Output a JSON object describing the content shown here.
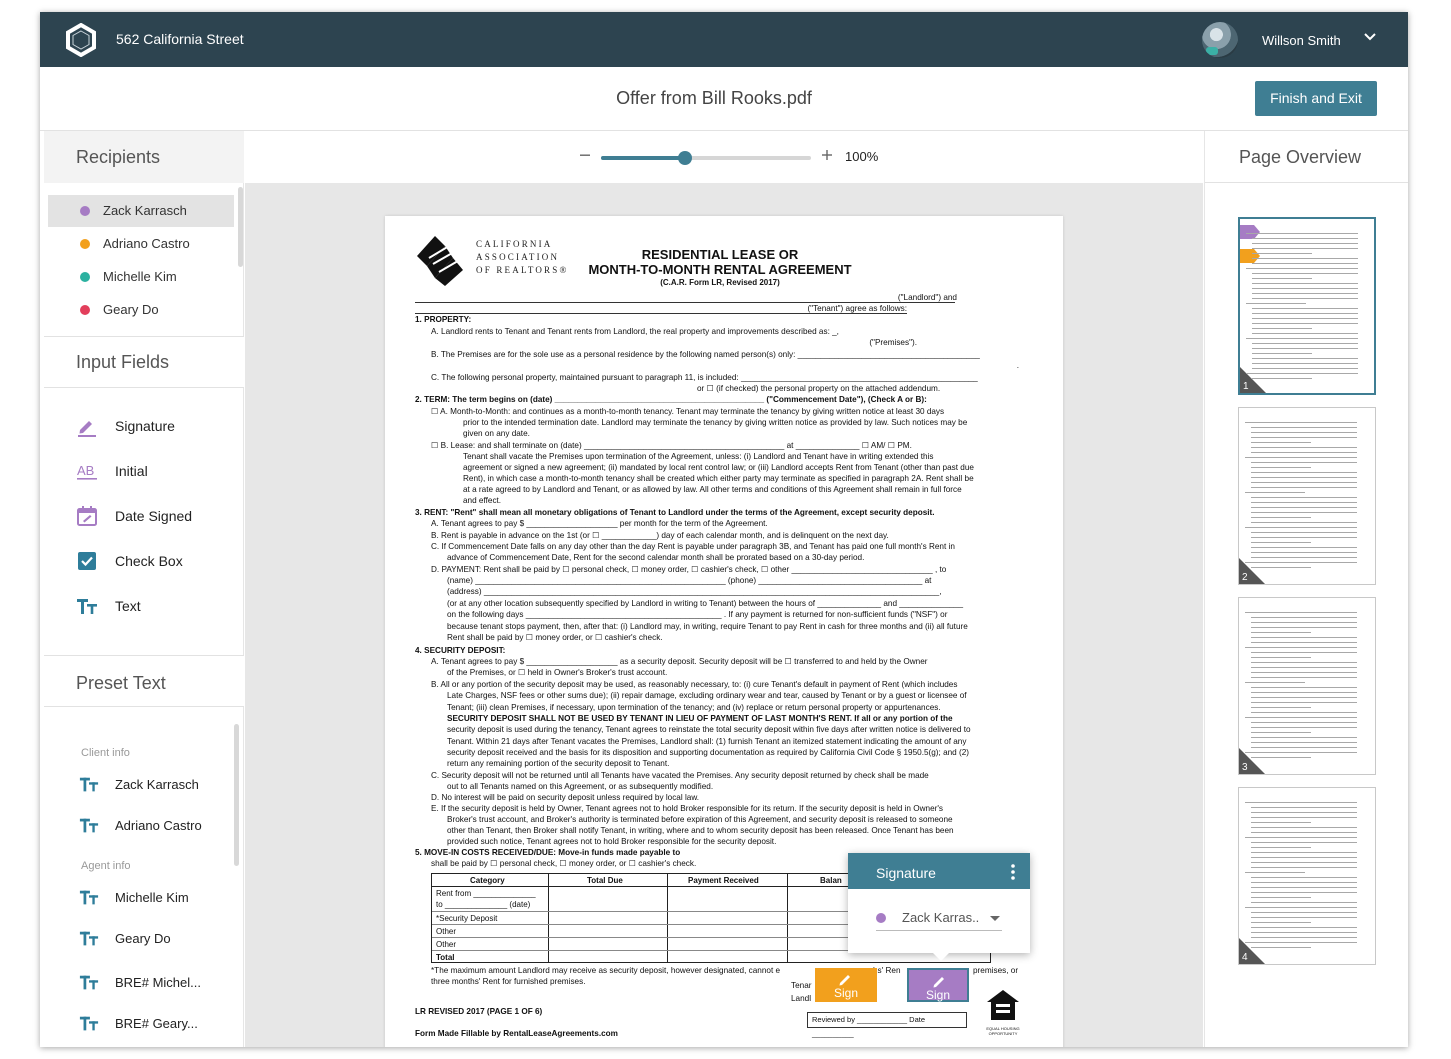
{
  "header": {
    "address": "562 California Street",
    "user_name": "Willson Smith",
    "logo_icon": "hexagon-ring-logo",
    "avatar_icon": "user-avatar",
    "dropdown_icon": "chevron-down-icon"
  },
  "document": {
    "title": "Offer from Bill Rooks.pdf",
    "finish_label": "Finish and Exit"
  },
  "left": {
    "recipients_title": "Recipients",
    "recipients": [
      {
        "name": "Zack Karrasch",
        "color": "#a67cc4"
      },
      {
        "name": "Adriano Castro",
        "color": "#f2a01d"
      },
      {
        "name": "Michelle Kim",
        "color": "#2bb1a0"
      },
      {
        "name": "Geary Do",
        "color": "#e23e5b"
      }
    ],
    "input_fields_title": "Input Fields",
    "input_fields": [
      {
        "label": "Signature",
        "icon": "pen-icon"
      },
      {
        "label": "Initial",
        "icon": "initials-ab-icon"
      },
      {
        "label": "Date Signed",
        "icon": "calendar-icon"
      },
      {
        "label": "Check Box",
        "icon": "checkbox-icon"
      },
      {
        "label": "Text",
        "icon": "text-tt-icon"
      }
    ],
    "preset_text_title": "Preset Text",
    "preset_groups": [
      {
        "label": "Client info",
        "items": [
          "Zack Karrasch",
          "Adriano Castro"
        ]
      },
      {
        "label": "Agent info",
        "items": [
          "Michelle Kim",
          "Geary Do",
          "BRE# Michel...",
          "BRE# Geary..."
        ]
      }
    ]
  },
  "zoom": {
    "value": "100%",
    "level_fraction": 0.4
  },
  "right": {
    "title": "Page Overview",
    "pages": [
      "1",
      "2",
      "3",
      "4"
    ]
  },
  "colors": {
    "header": "#2d4450",
    "accent": "#3f7e93",
    "sign_orange": "#f2a01d",
    "sign_purple": "#a67cc4"
  },
  "pdf": {
    "org_lines": [
      "CALIFORNIA",
      "ASSOCIATION",
      "OF REALTORS®"
    ],
    "h1_line1": "RESIDENTIAL LEASE OR",
    "h1_line2": "MONTH-TO-MONTH RENTAL AGREEMENT",
    "h2": "(C.A.R. Form LR, Revised 2017)",
    "lines": [
      "(\"Landlord\") and",
      "(\"Tenant\") agree as follows:",
      "1.   PROPERTY:",
      "A.   Landlord rents to Tenant and Tenant rents from Landlord, the real property and improvements described as:  _,",
      "(\"Premises\").",
      "B.   The Premises are for the sole use as a personal residence by the following named person(s) only: ________________________________________",
      ".",
      "C.   The following personal property, maintained pursuant to paragraph 11, is included: ____________________________________________________",
      "or ☐ (if checked) the personal property on the attached addendum.",
      "2.   TERM: The term begins on (date) ______________________________________________ (\"Commencement Date\"), (Check A or B):",
      "☐  A.   Month-to-Month: and continues as a month-to-month tenancy. Tenant may terminate the tenancy by giving written notice at least 30 days",
      "prior to the intended termination date. Landlord may terminate the tenancy by giving written notice as provided by law. Such notices may be",
      "given on any date.",
      "☐  B.   Lease: and shall terminate on (date) ____________________________________________ at ______________ ☐ AM/ ☐ PM.",
      "Tenant shall vacate the Premises upon termination of the Agreement, unless: (i) Landlord and Tenant have in writing extended this",
      "agreement or signed a new agreement; (ii) mandated by local rent control law; or (iii) Landlord accepts Rent from Tenant (other than past due",
      "Rent), in which case a month-to-month tenancy shall be created which either party may terminate as specified in paragraph 2A. Rent shall be",
      "at a rate agreed to by Landlord and Tenant, or as allowed by law. All other terms and conditions of this Agreement shall remain in full force",
      "and effect.",
      "3.   RENT: \"Rent\" shall mean all monetary obligations of Tenant to Landlord under the terms of the Agreement, except security deposit.",
      "A.   Tenant agrees to pay $ ____________________ per month for the term of the Agreement.",
      "B.   Rent is payable in advance on the 1st (or ☐ ____________) day of each calendar month, and is delinquent on the next day.",
      "C.   If Commencement Date falls on any day other than the day Rent is payable under paragraph 3B, and Tenant has paid one full month's Rent in",
      "advance of Commencement Date, Rent for the second calendar month shall be prorated based on a 30-day period.",
      "D.   PAYMENT: Rent shall be paid by ☐ personal check, ☐ money order, ☐ cashier's check, ☐ other _______________________________ , to",
      "(name) _______________________________________________________ (phone) ____________________________________ at",
      "(address) ____________________________________________________________________________________________________,",
      "(or at any other location subsequently specified by Landlord in writing to Tenant) between the hours of ______________ and ______________",
      "on the following days ___________________________________________ . If any payment is returned for non-sufficient funds (\"NSF\") or",
      "because tenant stops payment, then, after that: (i) Landlord may, in writing, require Tenant to pay Rent in cash for three months and (ii) all future",
      "Rent shall be paid by ☐ money order, or ☐ cashier's check.",
      "4.   SECURITY DEPOSIT:",
      "A.   Tenant agrees to pay $ ____________________ as a security deposit. Security deposit will be ☐ transferred to and held by the Owner",
      "of the Premises, or ☐ held in Owner's Broker's trust account.",
      "B.   All or any portion of the security deposit may be used, as reasonably necessary, to: (i) cure Tenant's default in payment of Rent (which includes",
      "Late Charges, NSF fees or other sums due); (ii) repair damage, excluding ordinary wear and tear, caused by Tenant or by a guest or licensee of",
      "Tenant; (iii) clean Premises, if necessary, upon termination of the tenancy; and (iv) replace or return personal property or appurtenances.",
      "SECURITY DEPOSIT SHALL NOT BE USED BY TENANT IN LIEU OF PAYMENT OF LAST MONTH'S RENT. If all or any portion of the",
      "security deposit is used during the tenancy, Tenant agrees to reinstate the total security deposit within five days after written notice is delivered to",
      "Tenant. Within 21 days after Tenant vacates the Premises, Landlord shall: (1) furnish Tenant an itemized statement indicating the amount of any",
      "security deposit received and the basis for its disposition and supporting documentation as required by California Civil Code § 1950.5(g); and (2)",
      "return any remaining portion of the security deposit to Tenant.",
      "C.   Security deposit will not be returned until all Tenants have vacated the Premises. Any security deposit returned by check shall be made",
      "out to all Tenants named on this Agreement, or as subsequently modified.",
      "D.   No interest will be paid on security deposit unless required by local law.",
      "E.   If the security deposit is held by Owner, Tenant agrees not to hold Broker responsible for its return. If the security deposit is held in Owner's",
      "Broker's trust account, and Broker's authority is terminated before expiration of this Agreement, and security deposit is released to someone",
      "other than Tenant, then Broker shall notify Tenant, in writing, where and to whom security deposit has been released. Once Tenant has been",
      "provided such notice, Tenant agrees not to hold Broker responsible for the security deposit.",
      "5.   MOVE-IN COSTS RECEIVED/DUE: Move-in funds made payable to",
      "shall be paid by ☐ personal check, ☐ money order, or ☐ cashier's check."
    ],
    "table_headers": [
      "Category",
      "Total Due",
      "Payment Received",
      "Balan"
    ],
    "table_rows": [
      "Rent from ______________",
      "to ______________ (date)",
      "*Security Deposit",
      "Other",
      "Other",
      "Total"
    ],
    "footnote_1": "*The maximum amount Landlord may receive as security deposit, however designated, cannot e",
    "footnote_1b": "hs' Ren",
    "footnote_1c": "premises, or",
    "footnote_2": "three months' Rent for furnished premises.",
    "tenant_lbl": "Tenar",
    "landlord_lbl": "Landl",
    "revised": "LR REVISED 2017 (PAGE 1 OF 6)",
    "made_fillable": "Form Made Fillable by RentalLeaseAgreements.com",
    "reviewed": "Reviewed by ____________ Date __________",
    "eho_text": "EQUAL HOUSING OPPORTUNITY"
  },
  "sign_tags": [
    {
      "label": "Sign",
      "color": "#f2a01d"
    },
    {
      "label": "Sign",
      "color": "#a67cc4"
    }
  ],
  "popup": {
    "title": "Signature",
    "recipient": "Zack Karras..",
    "recipient_color": "#a67cc4"
  }
}
